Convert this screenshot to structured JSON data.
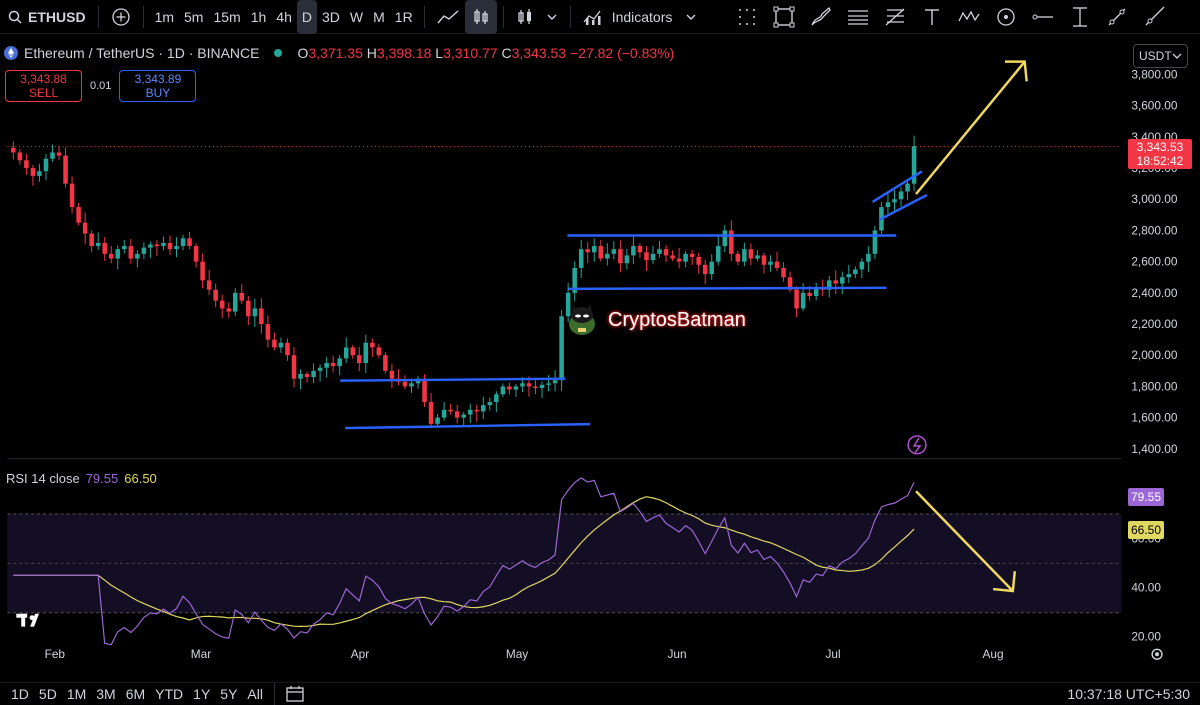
{
  "topbar": {
    "symbol": "ETHUSD",
    "intervals": [
      "1m",
      "5m",
      "15m",
      "1h",
      "4h",
      "D",
      "3D",
      "W",
      "M",
      "1R"
    ],
    "active_interval": "D",
    "indicators_label": "Indicators"
  },
  "legend": {
    "title": "Ethereum / TetherUS · 1D · BINANCE",
    "o_label": "O",
    "o": "3,371.35",
    "h_label": "H",
    "h": "3,398.18",
    "l_label": "L",
    "l": "3,310.77",
    "c_label": "C",
    "c": "3,343.53",
    "change": "−27.82 (−0.83%)"
  },
  "trade": {
    "sell_price": "3,343.88",
    "sell_label": "SELL",
    "spread": "0.01",
    "buy_price": "3,343.89",
    "buy_label": "BUY"
  },
  "currency": "USDT",
  "price_tag": {
    "price": "3,343.53",
    "countdown": "18:52:42"
  },
  "watermark": "CryptosBatman",
  "colors": {
    "up": "#26a69a",
    "down": "#f23645",
    "trendline": "#2962ff",
    "arrow": "#f0d860",
    "rsi": "#9c66d6",
    "rsi_ma": "#e0d860"
  },
  "rsi": {
    "label": "RSI 14 close",
    "value": "79.55",
    "ma_value": "66.50"
  },
  "time_axis": [
    "Feb",
    "Mar",
    "Apr",
    "May",
    "Jun",
    "Jul",
    "Aug"
  ],
  "bottombar": {
    "ranges": [
      "1D",
      "5D",
      "1M",
      "3M",
      "6M",
      "YTD",
      "1Y",
      "5Y",
      "All"
    ],
    "clock": "10:37:18 UTC+5:30"
  },
  "chart_data": {
    "type": "candlestick",
    "price_axis_ticks": [
      3800,
      3600,
      3400,
      3200,
      3000,
      2800,
      2600,
      2400,
      2200,
      2000,
      1800,
      1600,
      1400
    ],
    "price_axis_labels": [
      "3,800.00",
      "3,600.00",
      "3,400.00",
      "3,200.00",
      "3,000.00",
      "2,800.00",
      "2,600.00",
      "2,400.00",
      "2,200.00",
      "2,000.00",
      "1,800.00",
      "1,600.00",
      "1,400.00"
    ],
    "rsi_axis_ticks": [
      60,
      40,
      20
    ],
    "rsi_axis_labels": [
      "60.00",
      "40.00",
      "20.00"
    ],
    "closes": [
      3300,
      3250,
      3200,
      3150,
      3180,
      3260,
      3300,
      3280,
      3100,
      2950,
      2850,
      2780,
      2700,
      2720,
      2650,
      2620,
      2680,
      2700,
      2620,
      2650,
      2690,
      2710,
      2700,
      2720,
      2680,
      2700,
      2750,
      2700,
      2600,
      2480,
      2420,
      2350,
      2300,
      2280,
      2400,
      2350,
      2250,
      2300,
      2200,
      2100,
      2050,
      2080,
      2000,
      1850,
      1880,
      1860,
      1900,
      1920,
      1950,
      1930,
      1980,
      2050,
      2000,
      1950,
      2080,
      2050,
      2000,
      1900,
      1850,
      1830,
      1800,
      1820,
      1850,
      1700,
      1560,
      1600,
      1650,
      1640,
      1600,
      1620,
      1650,
      1640,
      1680,
      1700,
      1750,
      1800,
      1780,
      1800,
      1820,
      1800,
      1790,
      1810,
      1820,
      1840,
      2250,
      2400,
      2560,
      2680,
      2660,
      2700,
      2620,
      2650,
      2680,
      2590,
      2640,
      2700,
      2660,
      2610,
      2650,
      2680,
      2640,
      2620,
      2600,
      2650,
      2630,
      2580,
      2520,
      2600,
      2700,
      2800,
      2650,
      2600,
      2680,
      2620,
      2640,
      2580,
      2600,
      2560,
      2500,
      2420,
      2300,
      2400,
      2380,
      2430,
      2420,
      2480,
      2460,
      2500,
      2520,
      2550,
      2600,
      2650,
      2800,
      2950,
      2980,
      3000,
      3050,
      3100,
      3340
    ]
  }
}
